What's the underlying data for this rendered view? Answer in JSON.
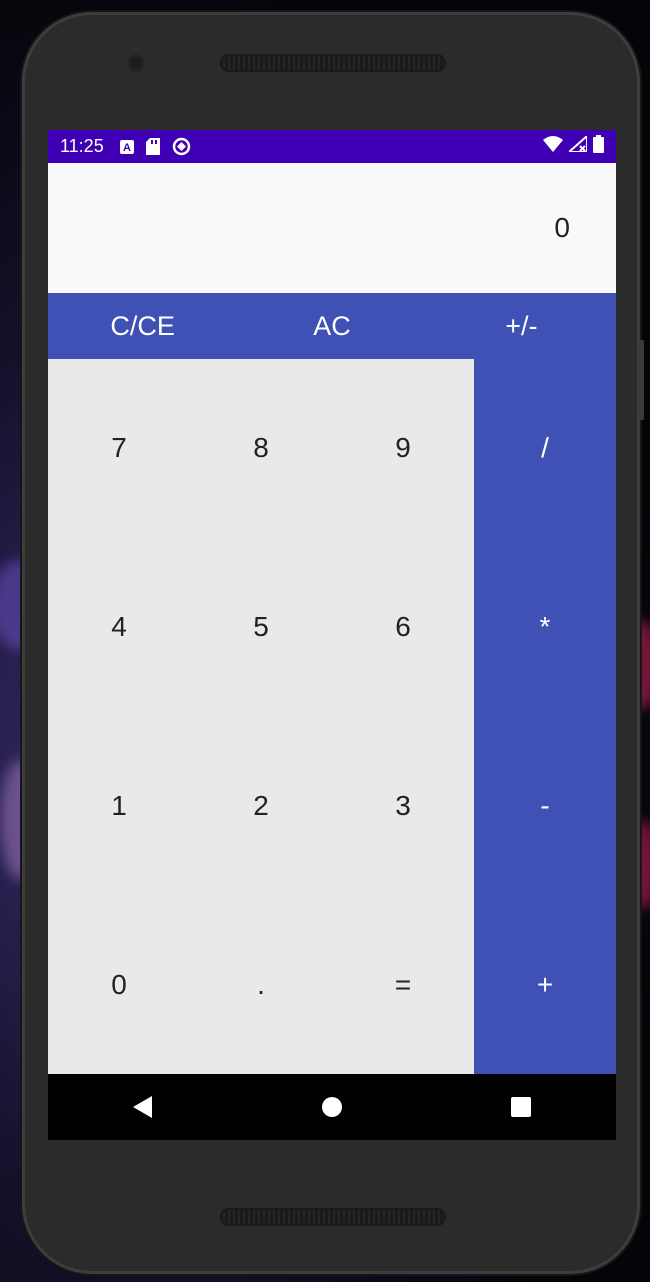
{
  "status_bar": {
    "time": "11:25",
    "left_icons": [
      "keyboard-a-icon",
      "sd-card-icon",
      "data-saver-icon"
    ],
    "right_icons": [
      "wifi-icon",
      "cell-signal-icon",
      "battery-icon"
    ],
    "background": "#3f00b5"
  },
  "display": {
    "value": "0"
  },
  "top_row": {
    "clear_label": "C/CE",
    "all_clear_label": "AC",
    "sign_label": "+/-"
  },
  "digits": [
    "7",
    "8",
    "9",
    "4",
    "5",
    "6",
    "1",
    "2",
    "3",
    "0",
    ".",
    "="
  ],
  "operators": [
    "/",
    "*",
    "-",
    "+"
  ],
  "navigation": [
    "back-icon",
    "home-icon",
    "recents-icon"
  ],
  "colors": {
    "accent": "#3f51b5",
    "keypad_background": "#e9e9e9",
    "display_background": "#fafafa"
  }
}
